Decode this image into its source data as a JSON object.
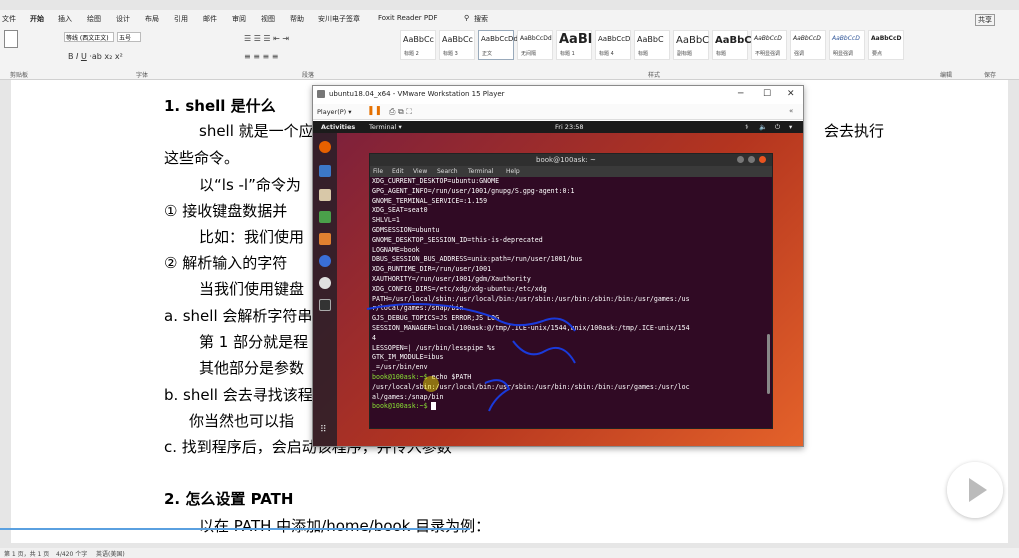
{
  "word": {
    "menu": [
      "文件",
      "开始",
      "插入",
      "绘图",
      "设计",
      "布局",
      "引用",
      "邮件",
      "审阅",
      "视图",
      "帮助",
      "安川电子签章",
      "Foxit Reader PDF",
      "搜索"
    ],
    "share": "共享",
    "ribbon_groups": [
      "剪贴板",
      "字体",
      "段落",
      "样式",
      "编辑",
      "保存"
    ],
    "font_name": "等线 (西文正文)",
    "font_size": "五号",
    "styles": [
      {
        "preview": "AaBbCc",
        "name": "标题 2"
      },
      {
        "preview": "AaBbCc",
        "name": "标题 3"
      },
      {
        "preview": "AaBbCcDd",
        "name": "正文"
      },
      {
        "preview": "AaBbCcDd",
        "name": "无间隔"
      },
      {
        "preview": "AaBl",
        "name": "标题 1"
      },
      {
        "preview": "AaBbCcD",
        "name": "标题 4"
      },
      {
        "preview": "AaBbC",
        "name": "标题"
      },
      {
        "preview": "AaBbC",
        "name": "副标题"
      },
      {
        "preview": "AaBbC",
        "name": "标题"
      },
      {
        "preview": "AaBbCcD",
        "name": "不明显强调"
      },
      {
        "preview": "AaBbCcD",
        "name": "强调"
      },
      {
        "preview": "AaBbCcD",
        "name": "明显强调"
      },
      {
        "preview": "AaBbCcD",
        "name": "要点"
      }
    ],
    "doc_lines": [
      "1. shell 是什么",
      "shell 就是一个应",
      "会去执行",
      "这些命令。",
      "以“ls   -l”命令为",
      "①  接收键盘数据并",
      "比如：我们使用",
      "②  解析输入的字符",
      "当我们使用键盘",
      "a. shell 会解析字符串",
      "第 1 部分就是程",
      "其他部分是参数",
      "b. shell 会去寻找该程",
      "你当然也可以指",
      "c.  找到程序后，会启动该程序，并传入参数",
      "2.  怎么设置 PATH",
      "以在 PATH 中添加/home/book 目录为例："
    ],
    "status": [
      "第 1 页，共 1 页",
      "4/420 个字",
      "英语(美国)"
    ]
  },
  "vm": {
    "title": "ubuntu18.04_x64 - VMware Workstation 15 Player",
    "player_menu": "Player(P) ▾",
    "activities": "Activities",
    "terminal_menu": "Terminal ▾",
    "clock": "Fri 23:58",
    "term_title": "book@100ask: ~",
    "term_menu": [
      "File",
      "Edit",
      "View",
      "Search",
      "Terminal",
      "Help"
    ],
    "term_lines": [
      "XDG_CURRENT_DESKTOP=ubuntu:GNOME",
      "GPG_AGENT_INFO=/run/user/1001/gnupg/S.gpg-agent:0:1",
      "GNOME_TERMINAL_SERVICE=:1.159",
      "XDG_SEAT=seat0",
      "SHLVL=1",
      "GDMSESSION=ubuntu",
      "GNOME_DESKTOP_SESSION_ID=this-is-deprecated",
      "LOGNAME=book",
      "DBUS_SESSION_BUS_ADDRESS=unix:path=/run/user/1001/bus",
      "XDG_RUNTIME_DIR=/run/user/1001",
      "XAUTHORITY=/run/user/1001/gdm/Xauthority",
      "XDG_CONFIG_DIRS=/etc/xdg/xdg-ubuntu:/etc/xdg",
      "PATH=/usr/local/sbin:/usr/local/bin:/usr/sbin:/usr/bin:/sbin:/bin:/usr/games:/us",
      "r/local/games:/snap/bin",
      "GJS_DEBUG_TOPICS=JS ERROR;JS LOG",
      "SESSION_MANAGER=local/100ask:@/tmp/.ICE-unix/1544,unix/100ask:/tmp/.ICE-unix/154",
      "4",
      "LESSOPEN=| /usr/bin/lesspipe %s",
      "GTK_IM_MODULE=ibus",
      "_=/usr/bin/env"
    ],
    "prompt": "book@100ask:~$",
    "cmd": " echo $PATH",
    "out1": "/usr/local/sbin:/usr/local/bin:/usr/sbin:/usr/bin:/sbin:/bin:/usr/games:/usr/loc",
    "out2": "al/games:/snap/bin",
    "prompt2": "book@100ask:~$"
  }
}
